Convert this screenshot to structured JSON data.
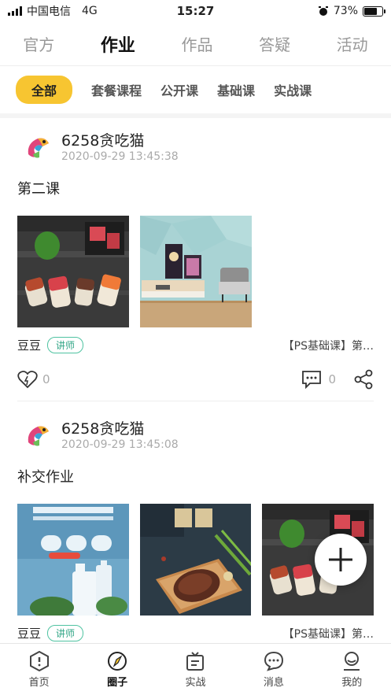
{
  "status": {
    "carrier": "中国电信",
    "network": "4G",
    "time": "15:27",
    "battery": "73%",
    "battery_level": 0.73
  },
  "top_tabs": [
    {
      "label": "官方"
    },
    {
      "label": "作业"
    },
    {
      "label": "作品"
    },
    {
      "label": "答疑"
    },
    {
      "label": "活动"
    }
  ],
  "chips": [
    {
      "label": "全部"
    },
    {
      "label": "套餐课程"
    },
    {
      "label": "公开课"
    },
    {
      "label": "基础课"
    },
    {
      "label": "实战课"
    }
  ],
  "posts": [
    {
      "user": "6258贪吃猫",
      "time": "2020-09-29 13:45:38",
      "title": "第二课",
      "author": "豆豆",
      "badge": "讲师",
      "course": "【PS基础课】第…",
      "likes": "0",
      "comments": "0"
    },
    {
      "user": "6258贪吃猫",
      "time": "2020-09-29 13:45:08",
      "title": "补交作业",
      "author": "豆豆",
      "badge": "讲师",
      "course": "【PS基础课】第…"
    }
  ],
  "bottom_nav": [
    {
      "label": "首页",
      "icon": "home-icon"
    },
    {
      "label": "圈子",
      "icon": "circle-icon"
    },
    {
      "label": "实战",
      "icon": "practice-icon"
    },
    {
      "label": "消息",
      "icon": "message-icon"
    },
    {
      "label": "我的",
      "icon": "profile-icon"
    }
  ],
  "colors": {
    "accent": "#f7c531",
    "badge": "#2fa585"
  }
}
